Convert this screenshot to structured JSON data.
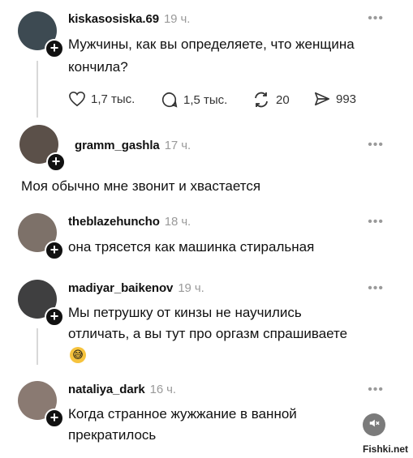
{
  "posts": [
    {
      "username": "kiskasosiska.69",
      "time": "19 ч.",
      "text_line1": "Мужчины, как вы определяете, что женщина",
      "text_line2": "кончила?",
      "likes": "1,7 тыс.",
      "comments": "1,5 тыс.",
      "reposts": "20",
      "shares": "993"
    },
    {
      "username": "gramm_gashla",
      "time": "17 ч.",
      "text": "Моя обычно мне звонит и хвастается"
    },
    {
      "username": "theblazehuncho",
      "time": "18 ч.",
      "text": "она трясется как машинка стиральная"
    },
    {
      "username": "madiyar_baikenov",
      "time": "19 ч.",
      "text_line1": "Мы петрушку от кинзы не научились",
      "text_line2": "отличать, а вы тут про оргазм спрашиваете",
      "emoji": "😅"
    },
    {
      "username": "nataliya_dark",
      "time": "16 ч.",
      "text_line1": "Когда странное жужжание в ванной",
      "text_line2": "прекратилось"
    }
  ],
  "more_glyph": "•••",
  "plus_glyph": "+",
  "watermark": "Fishki.net",
  "mute_icon": "speaker-muted-icon"
}
